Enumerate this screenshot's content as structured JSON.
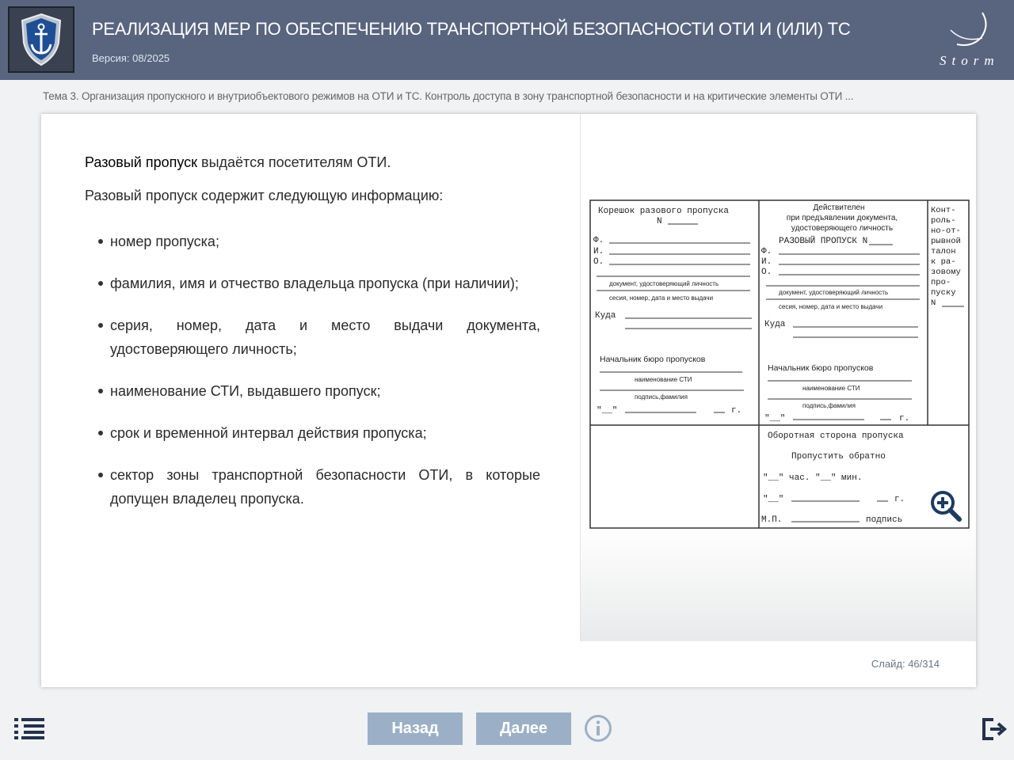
{
  "header": {
    "title": "РЕАЛИЗАЦИЯ МЕР ПО ОБЕСПЕЧЕНИЮ ТРАНСПОРТНОЙ БЕЗОПАСНОСТИ ОТИ И (ИЛИ) ТС",
    "version": "Версия: 08/2025",
    "brand": "Storm"
  },
  "topic": "Тема 3. Организация пропускного и внутриобъектового режимов на ОТИ и ТС. Контроль доступа в зону транспортной безопасности и на критические элементы ОТИ ...",
  "content": {
    "lead_strong": "Разовый пропуск",
    "lead_rest": " выдаётся посетителям ОТИ.",
    "intro": "Разовый пропуск содержит следующую информацию:",
    "bullets": [
      "номер пропуска;",
      "фамилия, имя и отчество владельца пропуска (при наличии);",
      "серия, номер, дата и место выдачи документа, удостоверяющего личность;",
      "наименование СТИ, выдавшего пропуск;",
      "срок и временной интервал действия пропуска;",
      "сектор зоны транспортной безопасности ОТИ, в которые допущен владелец пропуска."
    ]
  },
  "form": {
    "stub_title": "Корешок разового пропуска",
    "n": "N",
    "fio": [
      "Ф.",
      "И.",
      "О."
    ],
    "doc_caption": "документ, удостоверяющий личность",
    "doc_caption_main": "документ, удостоверяющий личность",
    "series_caption": "сесия, номер, дата и место выдачи",
    "series_caption_main": "сесия, номер, дата и место выдачи",
    "where": "Куда",
    "chief": "Начальник бюро пропусков",
    "sti_caption": "наименование СТИ",
    "sign_caption": "подпись,фамилия",
    "date_left": "\"__\"",
    "year": "г.",
    "valid_lines": [
      "Действителен",
      "при предъявлении документа,",
      "удостоверяющего личность"
    ],
    "main_title": "РАЗОВЫЙ ПРОПУСК N",
    "control_lines": [
      "Конт-",
      "роль-",
      "но-от-",
      "рывной",
      "талон",
      "к ра-",
      "зовому",
      "про-",
      "пуску",
      "N"
    ],
    "back_title": "Оборотная сторона пропуска",
    "pass_back": "Пропустить обратно",
    "time_line": "\"__\" час. \"__\" мин.",
    "stamp": "М.П.",
    "signature": "подпись"
  },
  "slide_counter": {
    "label": "Слайд:",
    "current": "46",
    "separator": "/",
    "total": "314"
  },
  "nav": {
    "back": "Назад",
    "next": "Далее"
  },
  "icons": {
    "logo": "anchor-shield-icon",
    "zoom": "zoom-in-icon",
    "menu": "list-icon",
    "info": "info-icon",
    "exit": "exit-icon"
  }
}
